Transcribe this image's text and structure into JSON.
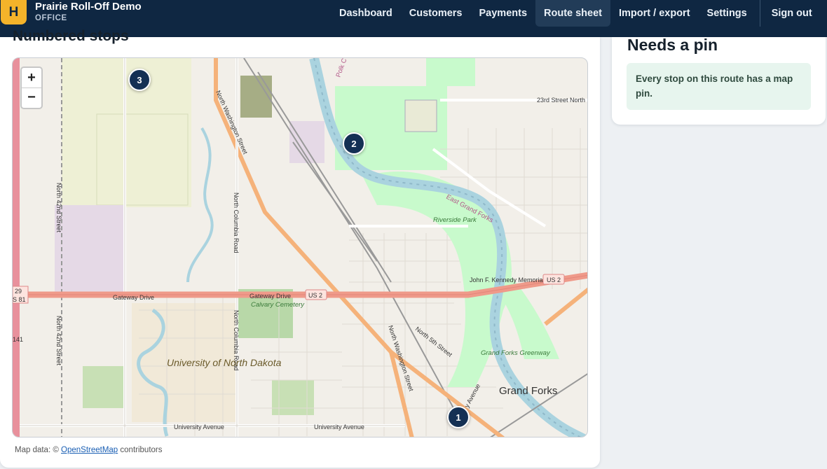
{
  "header": {
    "logo_letter": "H",
    "app_name": "Prairie Roll-Off Demo",
    "subtitle": "OFFICE",
    "nav": [
      {
        "label": "Dashboard"
      },
      {
        "label": "Customers"
      },
      {
        "label": "Payments"
      },
      {
        "label": "Route sheet",
        "active": true
      },
      {
        "label": "Import / export"
      },
      {
        "label": "Settings"
      },
      {
        "label": "Sign out"
      }
    ]
  },
  "main": {
    "title": "Numbered stops",
    "map": {
      "zoom_in": "+",
      "zoom_out": "−",
      "pins": [
        {
          "label": "1"
        },
        {
          "label": "2"
        },
        {
          "label": "3"
        }
      ],
      "labels": {
        "street_23rd": "23rd Street North",
        "north_washington": "North Washington Street",
        "north_washington_2": "North Washington Street",
        "north_columbia": "North Columbia Road",
        "north_columbia_2": "North Columbia Road",
        "north_42nd": "North 42nd Street",
        "north_42nd_2": "North 42nd Street",
        "gateway_drive": "Gateway Drive",
        "gateway_drive_2": "Gateway Drive",
        "us2": "US 2",
        "us2_east": "US 2",
        "hwy_29": "29",
        "hwy_s81": "S 81",
        "hwy_141": "141",
        "calvary_cemetery": "Calvary Cemetery",
        "riverside_park": "Riverside Park",
        "east_grand_forks": "East Grand Forks",
        "jfk_bridge": "John F. Kennedy Memorial Bridge",
        "university": "University of North Dakota",
        "grand_forks": "Grand Forks",
        "greenway": "Grand Forks Greenway",
        "north_5th": "North 5th Street",
        "university_avenue": "University Avenue",
        "university_avenue_2": "University Avenue",
        "polk": "Polk C",
        "avenue_frag": "y Avenue"
      }
    },
    "attribution_prefix": "Map data: ©",
    "attribution_link": "OpenStreetMap",
    "attribution_suffix": "contributors"
  },
  "side": {
    "title": "Needs a pin",
    "note": "Every stop on this route has a map pin."
  },
  "colors": {
    "nav_bg": "#0f2742",
    "nav_active": "#223c58",
    "logo": "#f4b32a",
    "pin": "#143054",
    "note_bg": "#e7f5ee",
    "river": "#aad3df",
    "park": "#c8facc",
    "primary_road": "#f5b27a",
    "highway": "#ef9a8a"
  }
}
